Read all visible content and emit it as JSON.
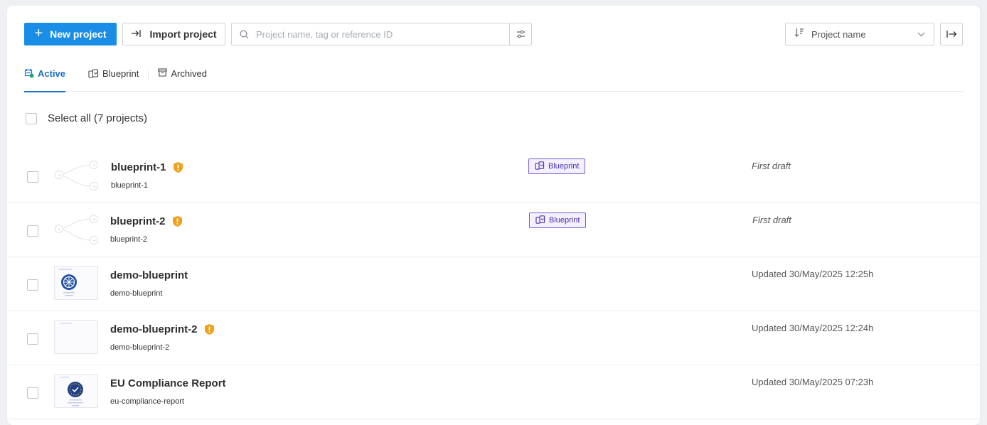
{
  "toolbar": {
    "new_project_label": "New project",
    "import_project_label": "Import project",
    "search_placeholder": "Project name, tag or reference ID",
    "sort_label": "Project name"
  },
  "tabs": [
    {
      "label": "Active"
    },
    {
      "label": "Blueprint"
    },
    {
      "label": "Archived"
    }
  ],
  "select_all_label": "Select all (7 projects)",
  "projects": [
    {
      "name": "blueprint-1",
      "slug": "blueprint-1",
      "badge": "Blueprint",
      "status": "First draft"
    },
    {
      "name": "blueprint-2",
      "slug": "blueprint-2",
      "badge": "Blueprint",
      "status": "First draft"
    },
    {
      "name": "demo-blueprint",
      "slug": "demo-blueprint",
      "status": "Updated 30/May/2025 12:25h"
    },
    {
      "name": "demo-blueprint-2",
      "slug": "demo-blueprint-2",
      "status": "Updated 30/May/2025 12:24h"
    },
    {
      "name": "EU Compliance Report",
      "slug": "eu-compliance-report",
      "status": "Updated 30/May/2025 07:23h"
    }
  ],
  "colors": {
    "primary": "#1a8ee6",
    "active_tab": "#1a6fc4",
    "badge_border": "#7a5ad6",
    "warning": "#f0a01a"
  },
  "icons": {
    "plus": "plus-icon",
    "import": "import-arrow-icon",
    "search": "search-icon",
    "filter": "filter-sliders-icon",
    "sort": "sort-icon",
    "chevron": "chevron-down-icon",
    "collapse": "collapse-panel-icon",
    "warning": "warning-shield-icon",
    "blueprint": "blueprint-icon"
  }
}
